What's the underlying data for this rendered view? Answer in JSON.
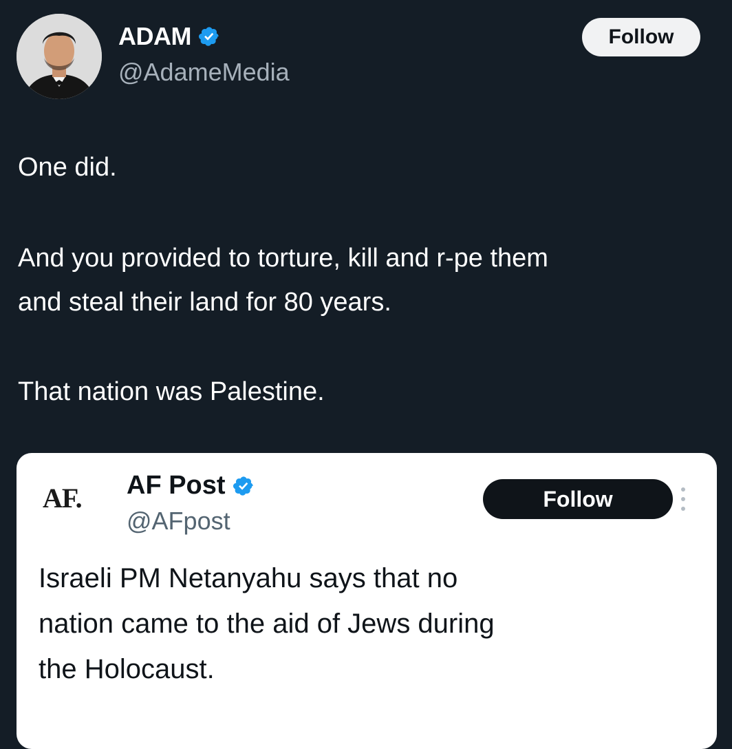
{
  "author": {
    "name": "ADAM",
    "handle": "@AdameMedia",
    "follow_label": "Follow"
  },
  "tweet": {
    "lines": [
      "One did.",
      "And you provided to torture, kill and r-pe them",
      "and steal their land for 80 years.",
      "That nation was Palestine."
    ]
  },
  "quoted": {
    "logo": "AF.",
    "name": "AF Post",
    "handle": "@AFpost",
    "follow_label": "Follow",
    "lines": [
      "Israeli PM Netanyahu says that no",
      "nation came to the aid of Jews during",
      "the Holocaust."
    ]
  },
  "colors": {
    "background": "#141d26",
    "verified": "#1d9bf0"
  },
  "icons": {
    "verified": "verified-badge-icon",
    "more": "more-options-icon"
  }
}
